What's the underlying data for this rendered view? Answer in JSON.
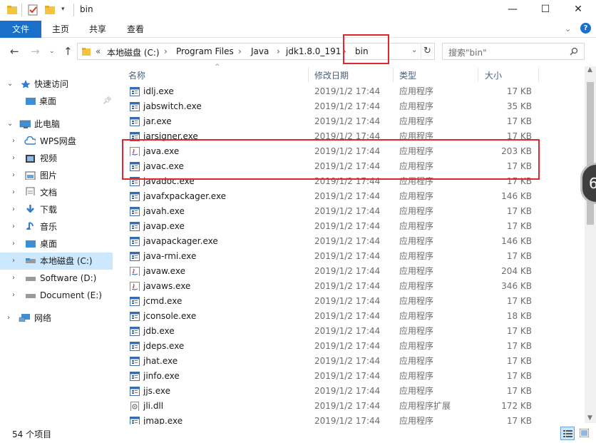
{
  "window": {
    "title": "bin"
  },
  "title_controls": {
    "minimize": "—",
    "maximize": "☐",
    "close": "✕"
  },
  "ribbon": {
    "tabs": [
      {
        "label": "文件"
      },
      {
        "label": "主页"
      },
      {
        "label": "共享"
      },
      {
        "label": "查看"
      }
    ]
  },
  "address": {
    "overflow": "«",
    "crumbs": [
      "本地磁盘 (C:)",
      "Program Files",
      "Java",
      "jdk1.8.0_191",
      "bin"
    ],
    "separator": "›"
  },
  "search": {
    "placeholder": "搜索\"bin\""
  },
  "sidebar": {
    "items": [
      {
        "label": "快速访问",
        "icon": "star-icon"
      },
      {
        "label": "桌面",
        "icon": "desktop-icon"
      },
      {
        "label": "此电脑",
        "icon": "computer-icon"
      },
      {
        "label": "WPS网盘",
        "icon": "cloud-icon"
      },
      {
        "label": "视频",
        "icon": "video-icon"
      },
      {
        "label": "图片",
        "icon": "picture-icon"
      },
      {
        "label": "文档",
        "icon": "document-icon"
      },
      {
        "label": "下载",
        "icon": "download-icon"
      },
      {
        "label": "音乐",
        "icon": "music-icon"
      },
      {
        "label": "桌面",
        "icon": "desktop-icon"
      },
      {
        "label": "本地磁盘 (C:)",
        "icon": "drive-icon"
      },
      {
        "label": "Software (D:)",
        "icon": "drive-icon"
      },
      {
        "label": "Document (E:)",
        "icon": "drive-icon"
      },
      {
        "label": "网络",
        "icon": "network-icon"
      }
    ]
  },
  "columns": {
    "name": "名称",
    "date": "修改日期",
    "type": "类型",
    "size": "大小"
  },
  "files": [
    {
      "name": "idlj.exe",
      "date": "2019/1/2 17:44",
      "type": "应用程序",
      "size": "17 KB",
      "icon": "exe-icon"
    },
    {
      "name": "jabswitch.exe",
      "date": "2019/1/2 17:44",
      "type": "应用程序",
      "size": "35 KB",
      "icon": "exe-icon"
    },
    {
      "name": "jar.exe",
      "date": "2019/1/2 17:44",
      "type": "应用程序",
      "size": "17 KB",
      "icon": "exe-icon"
    },
    {
      "name": "jarsigner.exe",
      "date": "2019/1/2 17:44",
      "type": "应用程序",
      "size": "17 KB",
      "icon": "exe-icon"
    },
    {
      "name": "java.exe",
      "date": "2019/1/2 17:44",
      "type": "应用程序",
      "size": "203 KB",
      "icon": "java-icon"
    },
    {
      "name": "javac.exe",
      "date": "2019/1/2 17:44",
      "type": "应用程序",
      "size": "17 KB",
      "icon": "exe-icon"
    },
    {
      "name": "javadoc.exe",
      "date": "2019/1/2 17:44",
      "type": "应用程序",
      "size": "17 KB",
      "icon": "exe-icon"
    },
    {
      "name": "javafxpackager.exe",
      "date": "2019/1/2 17:44",
      "type": "应用程序",
      "size": "146 KB",
      "icon": "exe-icon"
    },
    {
      "name": "javah.exe",
      "date": "2019/1/2 17:44",
      "type": "应用程序",
      "size": "17 KB",
      "icon": "exe-icon"
    },
    {
      "name": "javap.exe",
      "date": "2019/1/2 17:44",
      "type": "应用程序",
      "size": "17 KB",
      "icon": "exe-icon"
    },
    {
      "name": "javapackager.exe",
      "date": "2019/1/2 17:44",
      "type": "应用程序",
      "size": "146 KB",
      "icon": "exe-icon"
    },
    {
      "name": "java-rmi.exe",
      "date": "2019/1/2 17:44",
      "type": "应用程序",
      "size": "17 KB",
      "icon": "exe-icon"
    },
    {
      "name": "javaw.exe",
      "date": "2019/1/2 17:44",
      "type": "应用程序",
      "size": "204 KB",
      "icon": "java-icon"
    },
    {
      "name": "javaws.exe",
      "date": "2019/1/2 17:44",
      "type": "应用程序",
      "size": "346 KB",
      "icon": "java-icon"
    },
    {
      "name": "jcmd.exe",
      "date": "2019/1/2 17:44",
      "type": "应用程序",
      "size": "17 KB",
      "icon": "exe-icon"
    },
    {
      "name": "jconsole.exe",
      "date": "2019/1/2 17:44",
      "type": "应用程序",
      "size": "18 KB",
      "icon": "exe-icon"
    },
    {
      "name": "jdb.exe",
      "date": "2019/1/2 17:44",
      "type": "应用程序",
      "size": "17 KB",
      "icon": "exe-icon"
    },
    {
      "name": "jdeps.exe",
      "date": "2019/1/2 17:44",
      "type": "应用程序",
      "size": "17 KB",
      "icon": "exe-icon"
    },
    {
      "name": "jhat.exe",
      "date": "2019/1/2 17:44",
      "type": "应用程序",
      "size": "17 KB",
      "icon": "exe-icon"
    },
    {
      "name": "jinfo.exe",
      "date": "2019/1/2 17:44",
      "type": "应用程序",
      "size": "17 KB",
      "icon": "exe-icon"
    },
    {
      "name": "jjs.exe",
      "date": "2019/1/2 17:44",
      "type": "应用程序",
      "size": "17 KB",
      "icon": "exe-icon"
    },
    {
      "name": "jli.dll",
      "date": "2019/1/2 17:44",
      "type": "应用程序扩展",
      "size": "172 KB",
      "icon": "dll-icon"
    },
    {
      "name": "jmap.exe",
      "date": "2019/1/2 17:44",
      "type": "应用程序",
      "size": "17 KB",
      "icon": "exe-icon"
    }
  ],
  "status": {
    "count": "54 个项目"
  },
  "overlay": {
    "badge": "6"
  },
  "colors": {
    "accent": "#1a6fc9",
    "annotation": "#e0272e",
    "selected": "#cce8ff"
  }
}
